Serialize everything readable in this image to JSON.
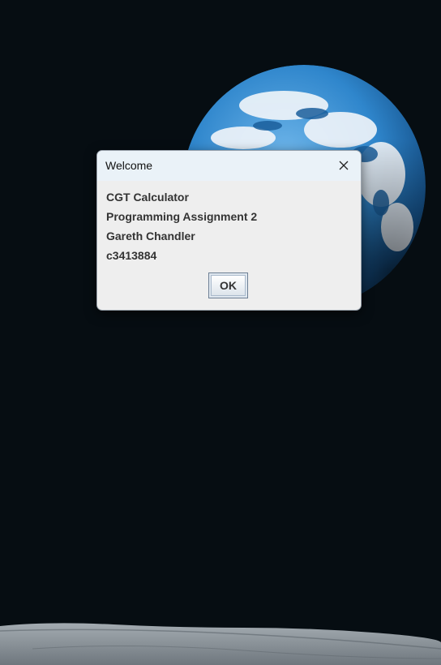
{
  "wallpaper": {
    "description_icon": "earth-rise-wallpaper",
    "colors": {
      "space": "#060d12",
      "earth_blue": "#3f8fd0",
      "moon_surface": "#8e969c"
    }
  },
  "dialog": {
    "title": "Welcome",
    "close_icon": "close-icon",
    "lines": [
      "CGT Calculator",
      "Programming Assignment 2",
      "Gareth Chandler",
      "c3413884"
    ],
    "ok_label": "OK"
  }
}
